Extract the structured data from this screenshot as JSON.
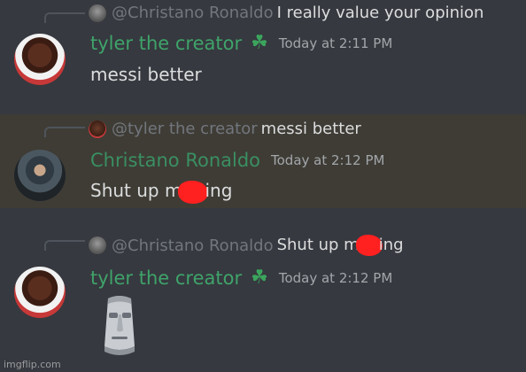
{
  "messages": [
    {
      "reply": {
        "mention": "@Christano Ronaldo",
        "text": "I really value your opinion"
      },
      "author": "tyler the creator",
      "time": "Today at 2:11 PM",
      "content": "messi better"
    },
    {
      "reply": {
        "mention": "@tyler the creator",
        "text": "messi better"
      },
      "author": "Christano Ronaldo",
      "time": "Today at 2:12 PM",
      "content_start": "Shut up m",
      "content_end": "ing"
    },
    {
      "reply": {
        "mention": "@Christano Ronaldo",
        "text_start": "Shut up m",
        "text_end": "ing"
      },
      "author": "tyler the creator",
      "time": "Today at 2:12 PM",
      "content_icon": "moai-emoji"
    }
  ],
  "icons": {
    "badge": "clover-badge-icon"
  },
  "colors": {
    "background": "#36393f",
    "highlight": "#3e3c35",
    "username": "#3fa36a",
    "timestamp": "#a3a6aa",
    "mention": "#72767d"
  },
  "watermark": "imgflip.com"
}
